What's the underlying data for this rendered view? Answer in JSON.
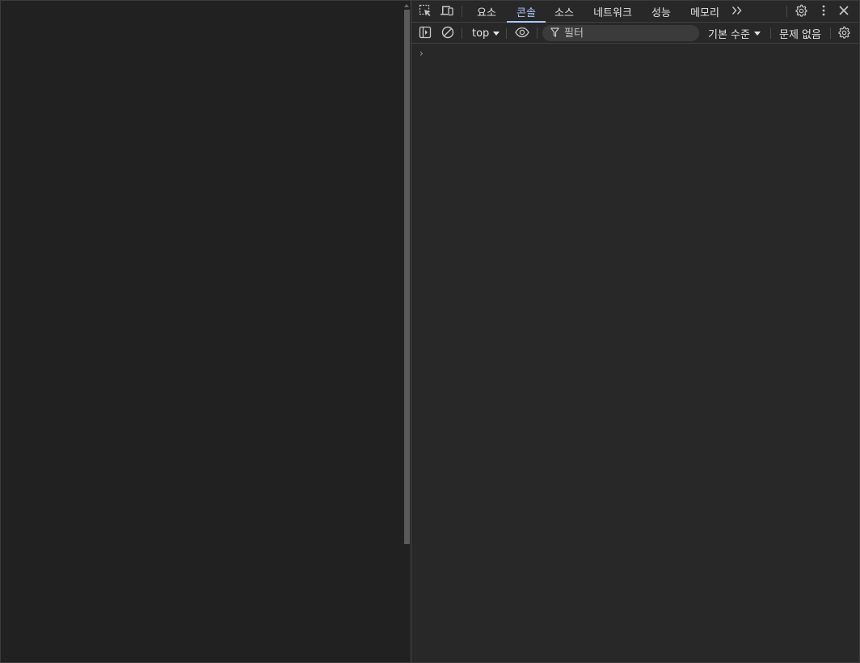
{
  "devtools": {
    "tabs": [
      {
        "label": "요소",
        "active": false
      },
      {
        "label": "콘솔",
        "active": true
      },
      {
        "label": "소스",
        "active": false
      },
      {
        "label": "네트워크",
        "active": false
      },
      {
        "label": "성능",
        "active": false
      },
      {
        "label": "메모리",
        "active": false
      }
    ],
    "console_toolbar": {
      "context": "top",
      "filter_placeholder": "필터",
      "levels": "기본 수준",
      "issues": "문제 없음"
    },
    "prompt_symbol": "›"
  },
  "colors": {
    "accent": "#a8c7fa",
    "panel_bg": "#282828",
    "page_bg": "#212121"
  },
  "icons": [
    "inspect-element-icon",
    "device-toolbar-icon",
    "more-tabs-icon",
    "settings-gear-icon",
    "kebab-menu-icon",
    "close-icon",
    "sidebar-toggle-icon",
    "clear-console-icon",
    "live-expression-eye-icon",
    "filter-funnel-icon",
    "console-settings-gear-icon",
    "prompt-chevron-icon"
  ]
}
